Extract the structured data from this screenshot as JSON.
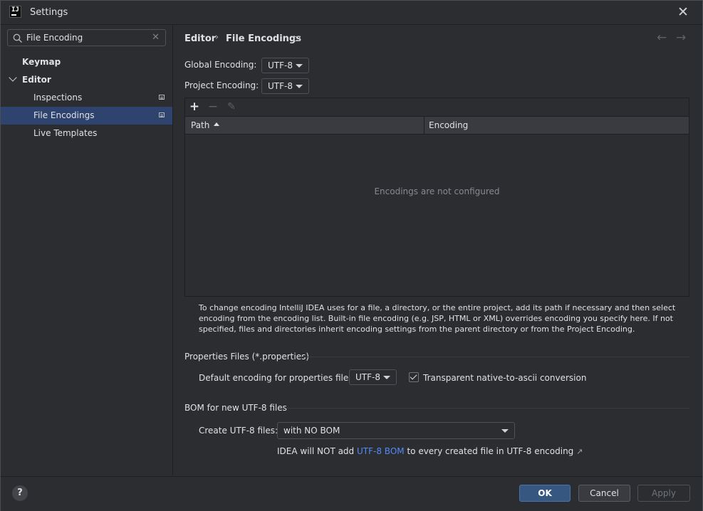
{
  "window": {
    "title": "Settings"
  },
  "search": {
    "value": "File Encoding",
    "placeholder": ""
  },
  "sidebar": {
    "items": [
      {
        "label": "Keymap"
      },
      {
        "label": "Editor"
      },
      {
        "label": "Inspections"
      },
      {
        "label": "File Encodings"
      },
      {
        "label": "Live Templates"
      }
    ]
  },
  "breadcrumb": {
    "parent": "Editor",
    "current": "File Encodings",
    "separator": "›"
  },
  "nav": {
    "back": "←",
    "forward": "→"
  },
  "encodings": {
    "global_label": "Global Encoding:",
    "global_value": "UTF-8",
    "project_label": "Project Encoding:",
    "project_value": "UTF-8"
  },
  "table": {
    "columns": [
      "Path",
      "Encoding"
    ],
    "empty_text": "Encodings are not configured",
    "toolbar": {
      "add": "+",
      "remove": "−",
      "edit": "✎"
    }
  },
  "help_text": "To change encoding IntelliJ IDEA uses for a file, a directory, or the entire project, add its path if necessary and then select encoding from the encoding list. Built-in file encoding (e.g. JSP, HTML or XML) overrides encoding you specify here. If not specified, files and directories inherit encoding settings from the parent directory or from the Project Encoding.",
  "properties": {
    "section": "Properties Files (*.properties)",
    "default_label": "Default encoding for properties files:",
    "default_value": "UTF-8",
    "transparent_label": "Transparent native-to-ascii conversion",
    "transparent_checked": true
  },
  "bom": {
    "section": "BOM for new UTF-8 files",
    "create_label": "Create UTF-8 files:",
    "create_value": "with NO BOM",
    "note_prefix": "IDEA will NOT add",
    "note_link": "UTF-8 BOM",
    "note_suffix": "to every created file in UTF-8 encoding",
    "note_arrow": "↗"
  },
  "footer": {
    "help": "?",
    "ok": "OK",
    "cancel": "Cancel",
    "apply": "Apply"
  },
  "colors": {
    "accent": "#365880",
    "selection": "#2e436e",
    "link": "#548af7",
    "background": "#2b2d30"
  }
}
